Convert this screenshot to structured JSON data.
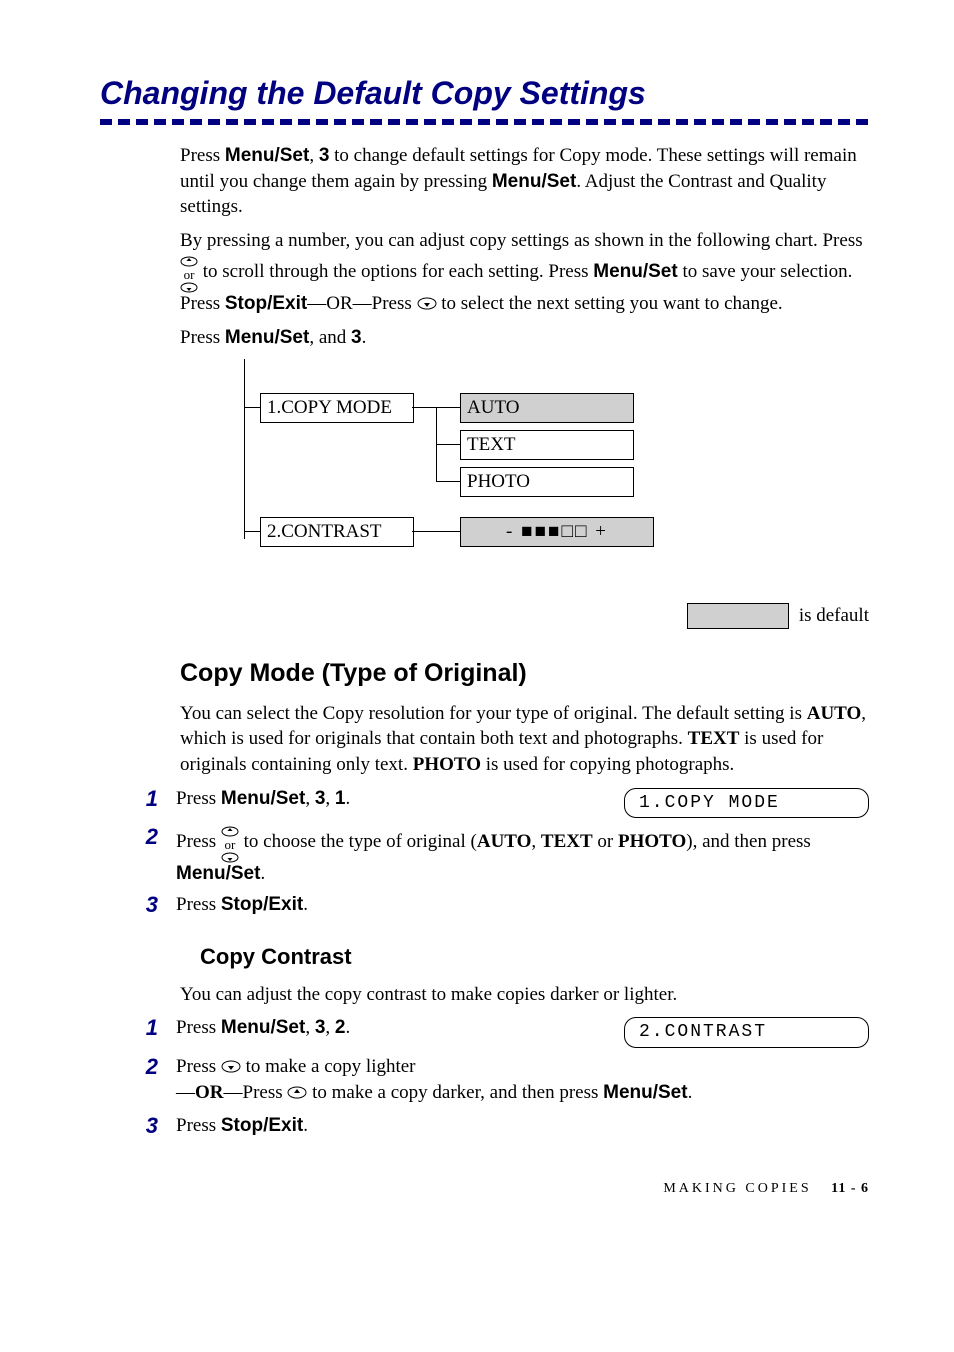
{
  "title": "Changing the Default Copy Settings",
  "intro": {
    "p1_pre": "Press ",
    "menu_set": "Menu/Set",
    "p1_mid1": ", ",
    "key_3": "3",
    "p1_mid2": " to change default settings for Copy mode. These settings will remain until you change them again by pressing ",
    "p1_post": ". Adjust the Contrast and Quality settings.",
    "p2_pre": "By pressing a number, you can adjust copy settings as shown in the following chart. Press ",
    "or": "or",
    "p2_mid": "  to scroll through the options for each setting. Press ",
    "p2_end_pre": "to save your selection. Press ",
    "stop_exit": "Stop/Exit",
    "or_dash": "—OR—",
    "p2_end_post": "Press ",
    "p2_end_tail": " to select the next setting you want to change.",
    "p3_pre": "Press ",
    "p3_mid": ", and ",
    "p3_end": "."
  },
  "diagram": {
    "row1": "1.COPY MODE",
    "row2": "2.CONTRAST",
    "auto": "AUTO",
    "text": "TEXT",
    "photo": "PHOTO",
    "contrast_visual": "- ■■■□□ +"
  },
  "legend": "is default",
  "copy_mode": {
    "heading": "Copy Mode (Type of Original)",
    "body": "You can select the Copy resolution for your type of original. The default setting is AUTO, which is used for originals that contain both text and photographs. TEXT is used for originals containing only text. PHOTO is used for copying photographs.",
    "step1_pre": "Press ",
    "key_1": "1",
    "lcd": "1.COPY MODE",
    "step2_pre": "Press ",
    "step2_mid": "  to choose the type of original (",
    "auto": "AUTO",
    "text": "TEXT",
    "photo": "PHOTO",
    "or_sep": " or ",
    "step2_post": "), and then press ",
    "step3_pre": "Press "
  },
  "copy_contrast": {
    "heading": "Copy Contrast",
    "body": "You can adjust the copy contrast to make copies darker or lighter.",
    "step1_pre": "Press ",
    "key_2": "2",
    "lcd": "2.CONTRAST",
    "step2_pre": "Press ",
    "step2_lighter": " to make a copy lighter",
    "step2_or_pre": "—",
    "step2_or": "OR",
    "step2_or_post": "—Press ",
    "step2_darker": " to make a copy darker, and then press ",
    "step3_pre": "Press "
  },
  "footer": {
    "section": "MAKING COPIES",
    "page": "11 - 6"
  },
  "chart_data": {
    "type": "table",
    "title": "Default Copy Settings Menu Tree",
    "rows": [
      {
        "menu": "1.COPY MODE",
        "options": [
          "AUTO",
          "TEXT",
          "PHOTO"
        ],
        "default": "AUTO"
      },
      {
        "menu": "2.CONTRAST",
        "options": [
          "- ■■■□□ +"
        ],
        "default": "- ■■■□□ +"
      }
    ]
  }
}
